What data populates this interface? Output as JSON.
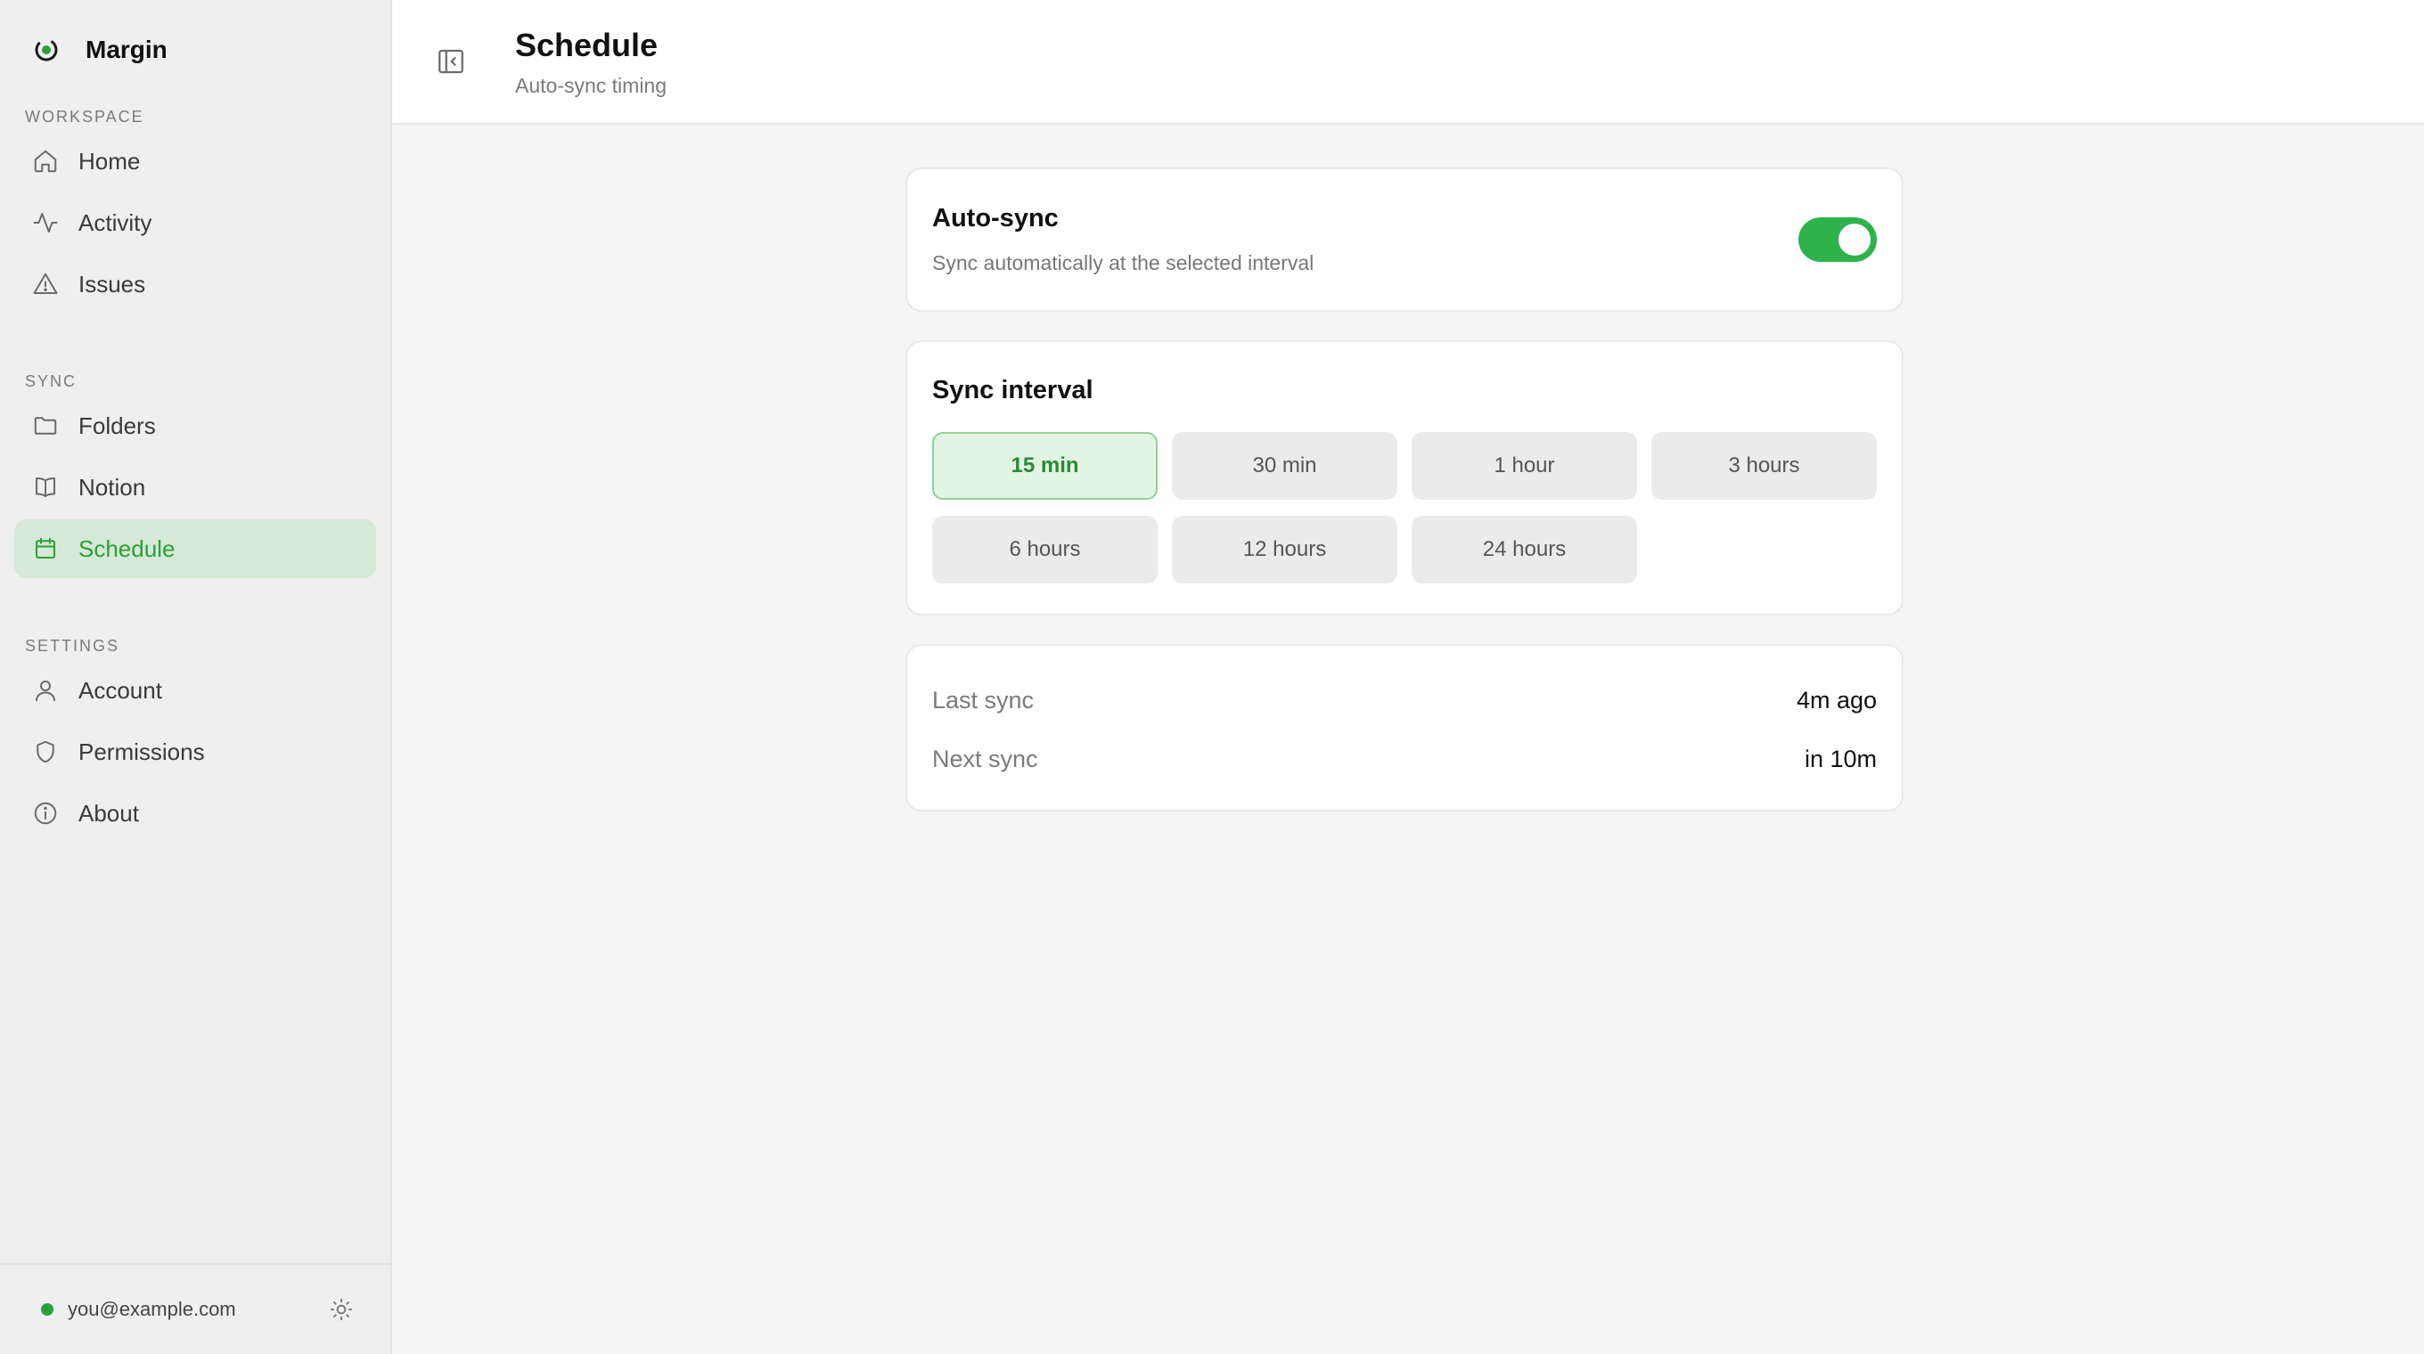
{
  "app": {
    "name": "Margin"
  },
  "sidebar": {
    "sections": [
      {
        "label": "WORKSPACE",
        "items": [
          {
            "label": "Home",
            "icon": "home-icon"
          },
          {
            "label": "Activity",
            "icon": "activity-icon"
          },
          {
            "label": "Issues",
            "icon": "warning-icon"
          }
        ]
      },
      {
        "label": "SYNC",
        "items": [
          {
            "label": "Folders",
            "icon": "folder-icon"
          },
          {
            "label": "Notion",
            "icon": "book-icon"
          },
          {
            "label": "Schedule",
            "icon": "calendar-icon",
            "active": true
          }
        ]
      },
      {
        "label": "SETTINGS",
        "items": [
          {
            "label": "Account",
            "icon": "user-icon"
          },
          {
            "label": "Permissions",
            "icon": "shield-icon"
          },
          {
            "label": "About",
            "icon": "info-icon"
          }
        ]
      }
    ],
    "footer": {
      "email": "you@example.com",
      "status_color": "#2aa13a"
    }
  },
  "header": {
    "title": "Schedule",
    "subtitle": "Auto-sync timing"
  },
  "autosync": {
    "title": "Auto-sync",
    "description": "Sync automatically at the selected interval",
    "enabled": true
  },
  "interval": {
    "title": "Sync interval",
    "options": [
      "15 min",
      "30 min",
      "1 hour",
      "3 hours",
      "6 hours",
      "12 hours",
      "24 hours"
    ],
    "selected": "15 min"
  },
  "status": {
    "last_label": "Last sync",
    "last_value": "4m ago",
    "next_label": "Next sync",
    "next_value": "in 10m"
  },
  "colors": {
    "accent": "#2db34a",
    "active_bg": "#d6e8d6"
  }
}
